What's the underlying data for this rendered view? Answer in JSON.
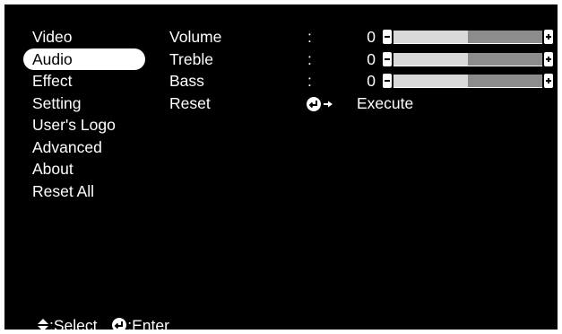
{
  "menu": {
    "items": [
      {
        "label": "Video"
      },
      {
        "label": "Audio"
      },
      {
        "label": "Effect"
      },
      {
        "label": "Setting"
      },
      {
        "label": "User's Logo"
      },
      {
        "label": "Advanced"
      },
      {
        "label": "About"
      },
      {
        "label": "Reset All"
      }
    ],
    "selected": "Audio"
  },
  "settings": {
    "volume": {
      "label": "Volume",
      "colon": ":",
      "value": "0",
      "level": 0.5
    },
    "treble": {
      "label": "Treble",
      "colon": ":",
      "value": "0",
      "level": 0.5
    },
    "bass": {
      "label": "Bass",
      "colon": ":",
      "value": "0",
      "level": 0.5
    },
    "reset": {
      "label": "Reset",
      "action": "Execute",
      "icon": "enter-arrow-icon"
    }
  },
  "footer": {
    "select_label": ":Select",
    "select_icon": "up-down-arrows-icon",
    "enter_label": ":Enter",
    "enter_icon": "enter-icon"
  },
  "colors": {
    "background": "#000000",
    "text": "#ffffff",
    "selected_bg": "#ffffff",
    "selected_text": "#000000",
    "bar_light": "#d9d9d9",
    "bar_dark": "#8c8c8c"
  }
}
